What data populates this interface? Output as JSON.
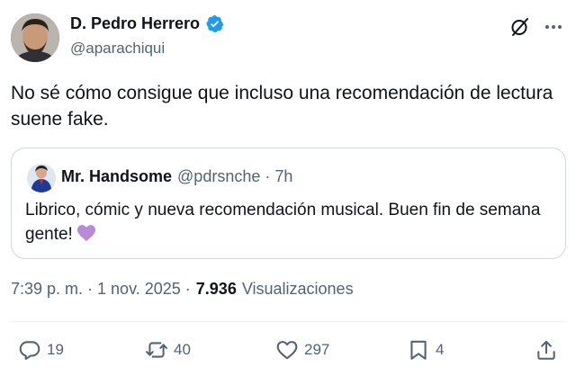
{
  "author": {
    "display_name": "D. Pedro Herrero",
    "handle": "@aparachiqui",
    "verified": true
  },
  "icons": {
    "verified": "verified-badge-icon",
    "grok": "grok-icon",
    "more": "more-dots-icon",
    "reply": "reply-icon",
    "repost": "repost-icon",
    "like": "heart-icon",
    "bookmark": "bookmark-icon",
    "share": "share-icon"
  },
  "colors": {
    "verified_blue": "#1d9bf0",
    "secondary_text": "#536471",
    "primary_text": "#0f1419",
    "border": "#cfd9de",
    "emoji_purple": "#b68bd8"
  },
  "tweet": {
    "text": "No sé cómo consigue que incluso una recomendación de lectura suene fake."
  },
  "quote": {
    "display_name": "Mr. Handsome",
    "meta": "@pdrsnche · 7h",
    "text": "Librico, cómic y nueva recomendación musical. Buen fin de semana gente!",
    "emoji": "purple-heart"
  },
  "meta": {
    "timestamp": "7:39 p. m. · 1 nov. 2025 ·",
    "views_count": "7.936",
    "views_label": "Visualizaciones"
  },
  "actions": {
    "replies": "19",
    "reposts": "40",
    "likes": "297",
    "bookmarks": "4"
  }
}
